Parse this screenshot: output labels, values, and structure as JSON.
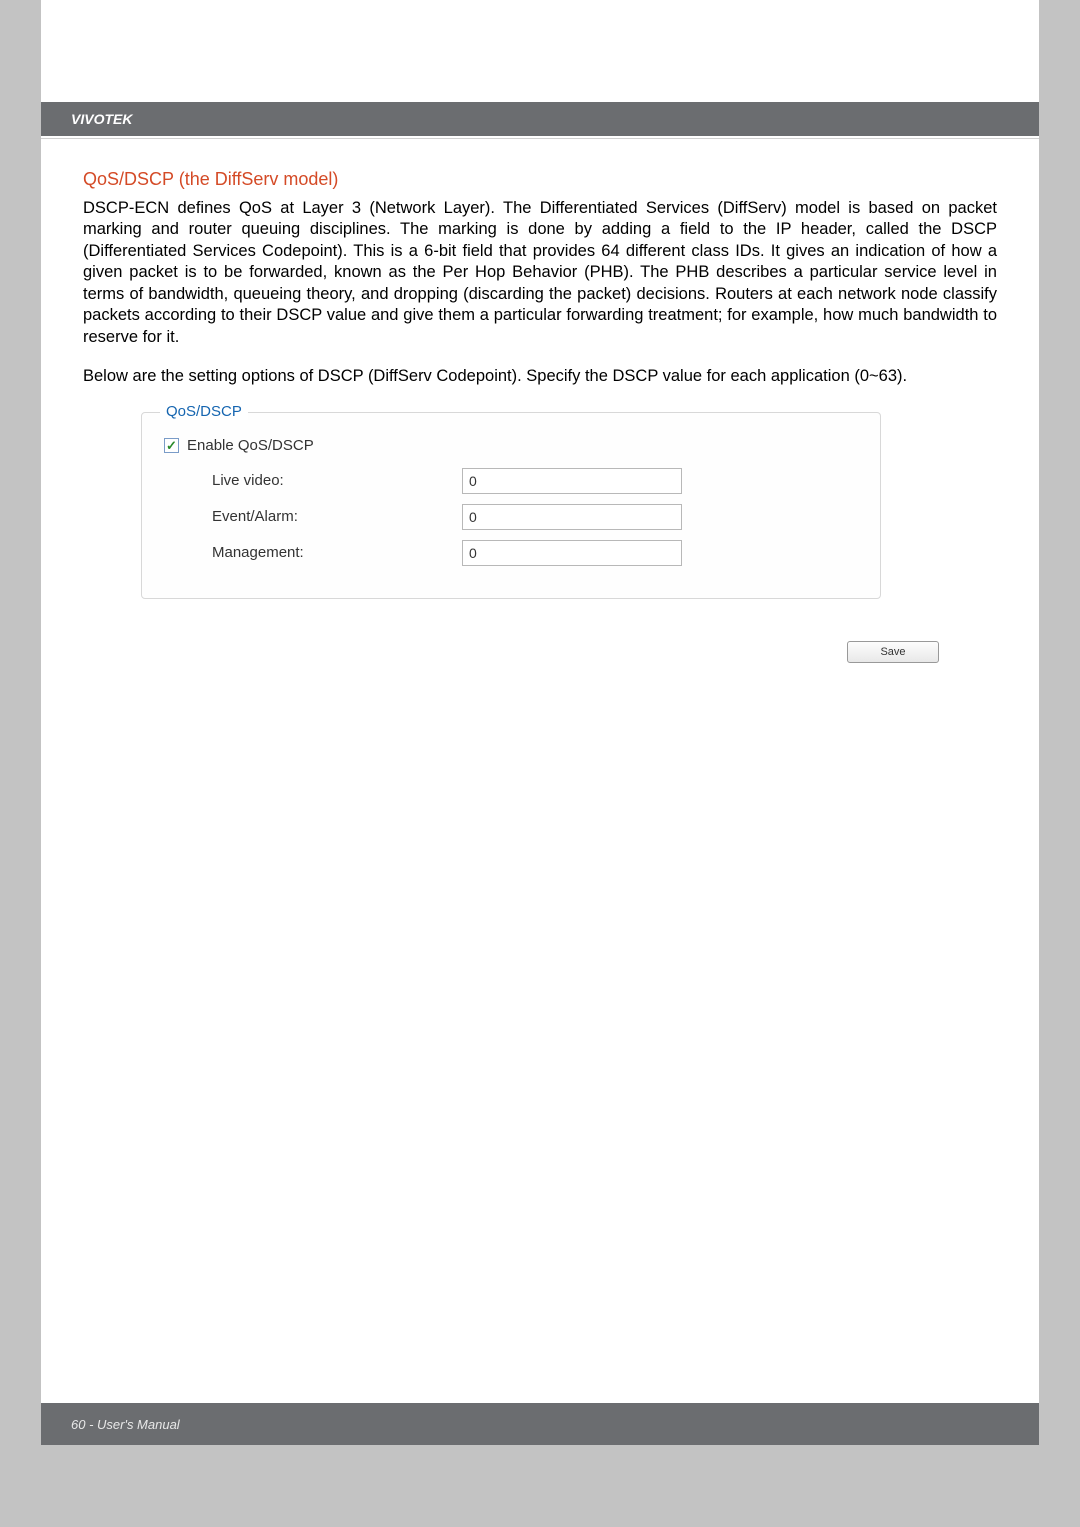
{
  "header": {
    "brand": "VIVOTEK"
  },
  "section": {
    "title": "QoS/DSCP (the DiffServ model)",
    "paragraph1": "DSCP-ECN defines QoS at Layer 3 (Network Layer). The Differentiated Services (DiffServ) model is based on packet marking and router queuing disciplines. The marking is done by adding a field to the IP header, called the DSCP (Differentiated Services Codepoint). This is a 6-bit field that provides 64 different class IDs. It gives an indication of how a given packet is to be forwarded, known as the Per Hop Behavior (PHB). The PHB describes a particular service level in terms of bandwidth, queueing theory, and dropping (discarding the packet) decisions. Routers at each network node classify packets according to their DSCP value and give them a particular forwarding treatment; for example, how much bandwidth to reserve for it.",
    "paragraph2": "Below are the setting options of DSCP (DiffServ Codepoint). Specify the DSCP value for each application (0~63)."
  },
  "panel": {
    "legend": "QoS/DSCP",
    "checkbox_label": "Enable QoS/DSCP",
    "fields": {
      "live_video": {
        "label": "Live video:",
        "value": "0"
      },
      "event_alarm": {
        "label": "Event/Alarm:",
        "value": "0"
      },
      "management": {
        "label": "Management:",
        "value": "0"
      }
    }
  },
  "buttons": {
    "save": "Save"
  },
  "footer": {
    "text": "60 - User's Manual"
  }
}
